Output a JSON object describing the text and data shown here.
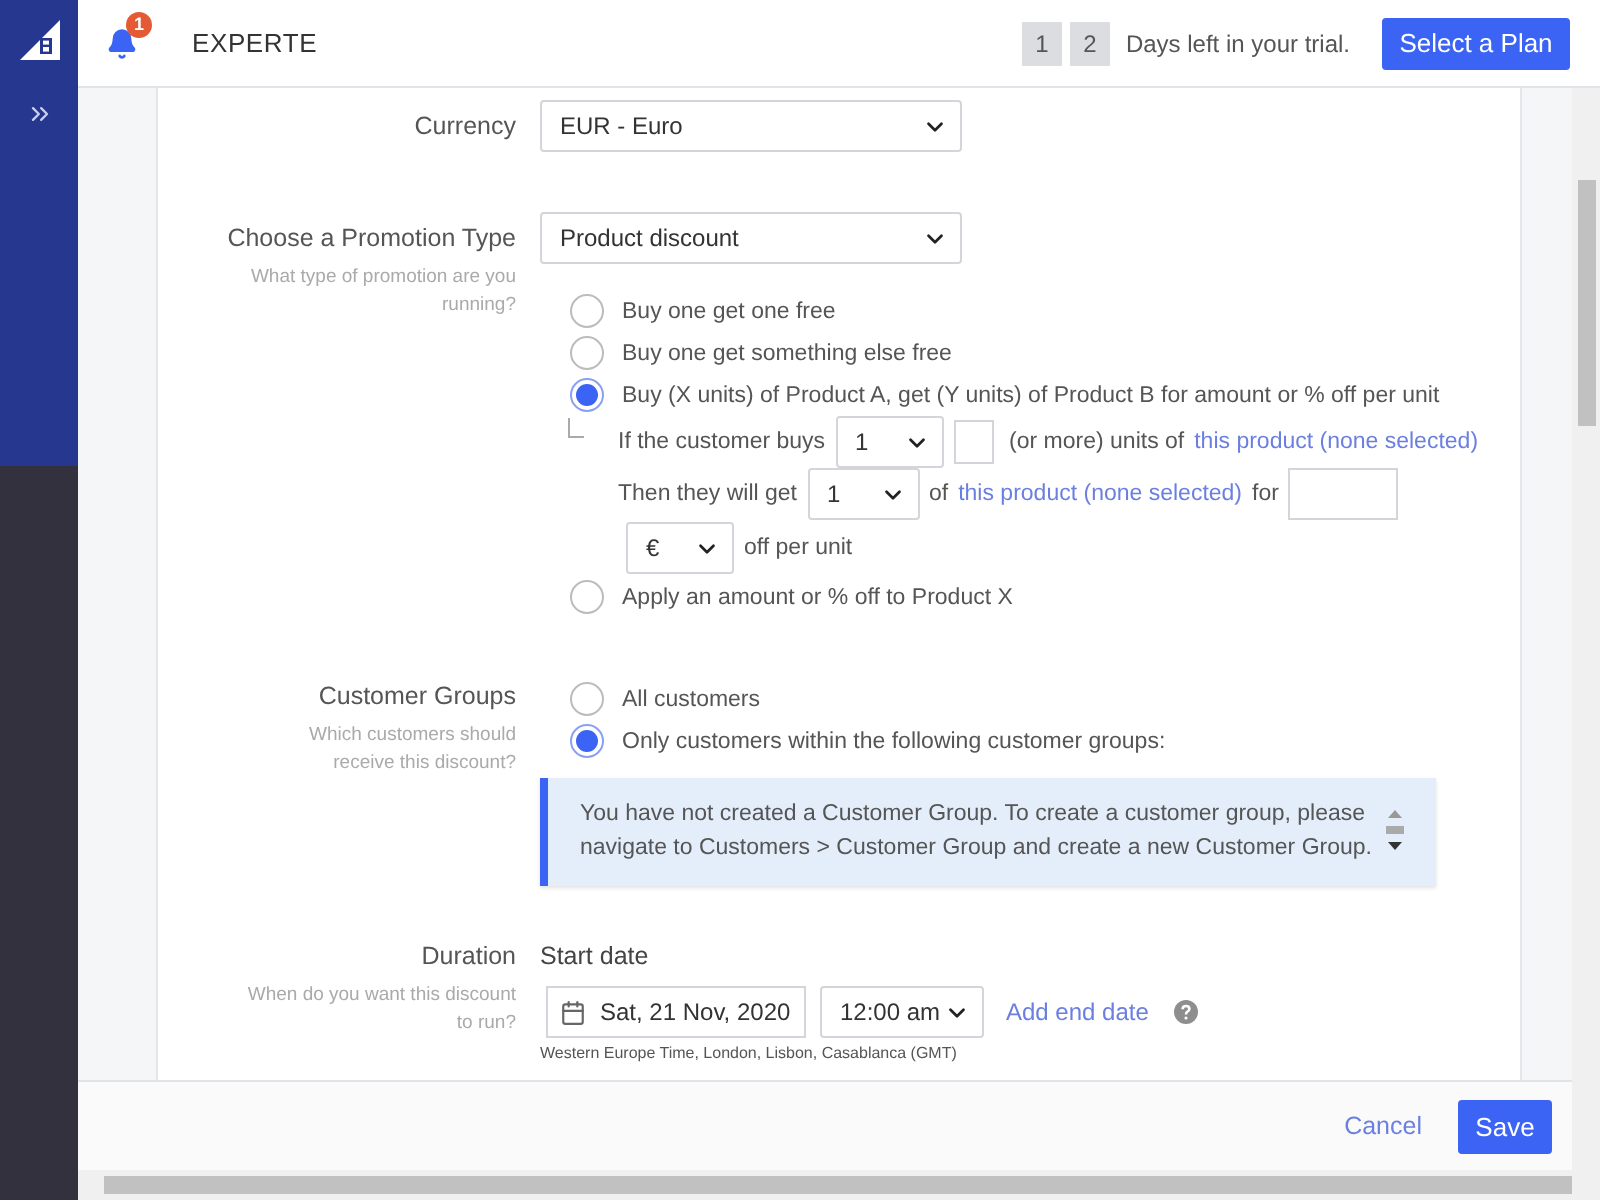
{
  "header": {
    "notification_count": "1",
    "store_name": "EXPERTE",
    "trial_days": [
      "1",
      "2"
    ],
    "trial_text": "Days left in your trial.",
    "plan_button": "Select a Plan"
  },
  "currency": {
    "label": "Currency",
    "value": "EUR - Euro"
  },
  "promotion": {
    "label": "Choose a Promotion Type",
    "hint": "What type of promotion are you running?",
    "value": "Product discount",
    "options": [
      {
        "label": "Buy one get one free",
        "selected": false
      },
      {
        "label": "Buy one get something else free",
        "selected": false
      },
      {
        "label": "Buy (X units) of Product A, get (Y units) of Product B for amount or % off per unit",
        "selected": true,
        "details": {
          "buy_prefix": "If the customer buys",
          "buy_qty": "1",
          "buy_suffix": "(or more) units of",
          "buy_link": "this product (none selected)",
          "get_prefix": "Then they will get",
          "get_qty": "1",
          "get_middle": "of",
          "get_link": "this product (none selected)",
          "get_suffix": "for",
          "discount_unit": "€",
          "discount_suffix": "off per unit"
        }
      },
      {
        "label": "Apply an amount or % off to Product X",
        "selected": false
      }
    ]
  },
  "customer_groups": {
    "label": "Customer Groups",
    "hint": "Which customers should receive this discount?",
    "options": [
      {
        "label": "All customers",
        "selected": false
      },
      {
        "label": "Only customers within the following customer groups:",
        "selected": true
      }
    ],
    "notice": "You have not created a Customer Group. To create a customer group, please navigate to Customers > Customer Group and create a new Customer Group."
  },
  "duration": {
    "label": "Duration",
    "hint": "When do you want this discount to run?",
    "start_label": "Start date",
    "date": "Sat, 21 Nov, 2020",
    "time": "12:00 am",
    "add_end_date": "Add end date",
    "timezone": "Western Europe Time, London, Lisbon, Casablanca (GMT)"
  },
  "footer": {
    "cancel": "Cancel",
    "save": "Save"
  }
}
